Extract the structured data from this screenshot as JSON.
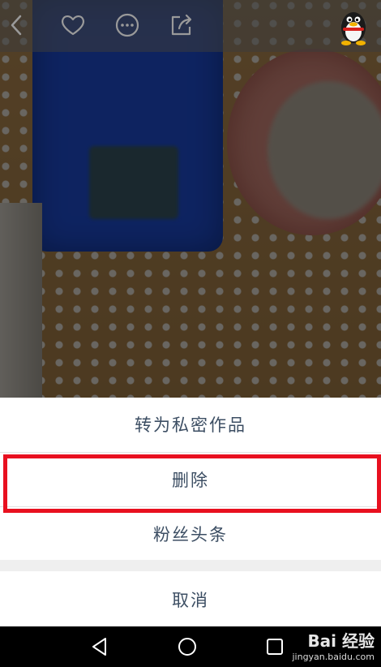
{
  "action_sheet": {
    "items": [
      {
        "label": "转为私密作品"
      },
      {
        "label": "删除"
      },
      {
        "label": "粉丝头条"
      }
    ],
    "cancel_label": "取消",
    "highlight_color": "#e8101f",
    "text_color": "#3c4e63"
  },
  "toolbar": {
    "icons": [
      "back-icon",
      "heart-icon",
      "more-icon",
      "share-icon",
      "qq-avatar"
    ]
  },
  "navbar": {
    "icons": [
      "back-triangle-icon",
      "home-circle-icon",
      "recents-square-icon"
    ]
  },
  "watermark": {
    "brand": "Bai 经验",
    "url": "jingyan.baidu.com"
  }
}
